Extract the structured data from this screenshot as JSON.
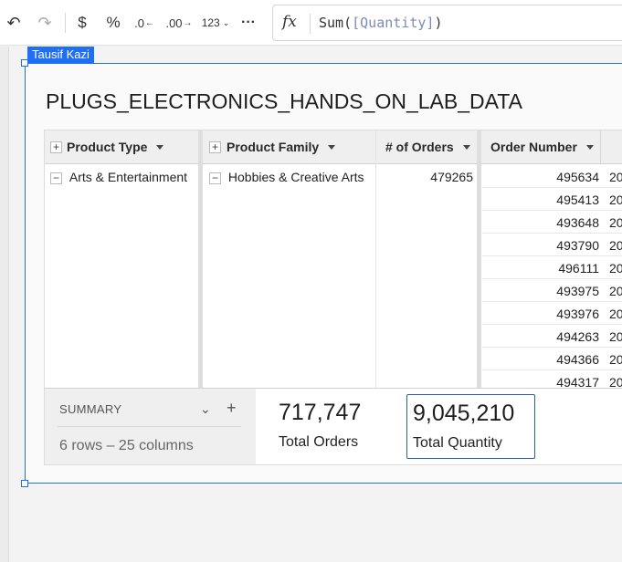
{
  "toolbar": {
    "undo_icon": "↶",
    "redo_icon": "↷",
    "currency_label": "$",
    "percent_label": "%",
    "decrease_decimal_label": ".0",
    "increase_decimal_label": ".00",
    "number_format_label": "123",
    "more_label": "···",
    "fx_label": "fx"
  },
  "formula": {
    "func": "Sum(",
    "ref": "[Quantity]",
    "close": ")"
  },
  "selection": {
    "owner_tag": "Tausif Kazi"
  },
  "element": {
    "title": "PLUGS_ELECTRONICS_HANDS_ON_LAB_DATA"
  },
  "pivot": {
    "columns": [
      {
        "label": "Product Type"
      },
      {
        "label": "Product Family"
      },
      {
        "label": "# of Orders"
      },
      {
        "label": "Order Number"
      }
    ],
    "product_type": "Arts & Entertainment",
    "product_family": "Hobbies & Creative Arts",
    "num_orders": "479265",
    "order_numbers": [
      "495634",
      "495413",
      "493648",
      "493790",
      "496111",
      "493975",
      "493976",
      "494263",
      "494366",
      "494317"
    ],
    "next_col_prefix": "20"
  },
  "summary": {
    "label": "SUMMARY",
    "rows_cols": "6 rows – 25 columns",
    "kpis": [
      {
        "value": "717,747",
        "label": "Total Orders"
      },
      {
        "value": "9,045,210",
        "label": "Total Quantity"
      }
    ]
  },
  "colors": {
    "selection": "#1f6ff2",
    "formula_ref": "#7d8bb4",
    "kpi_selected": "#2a5fb8"
  }
}
